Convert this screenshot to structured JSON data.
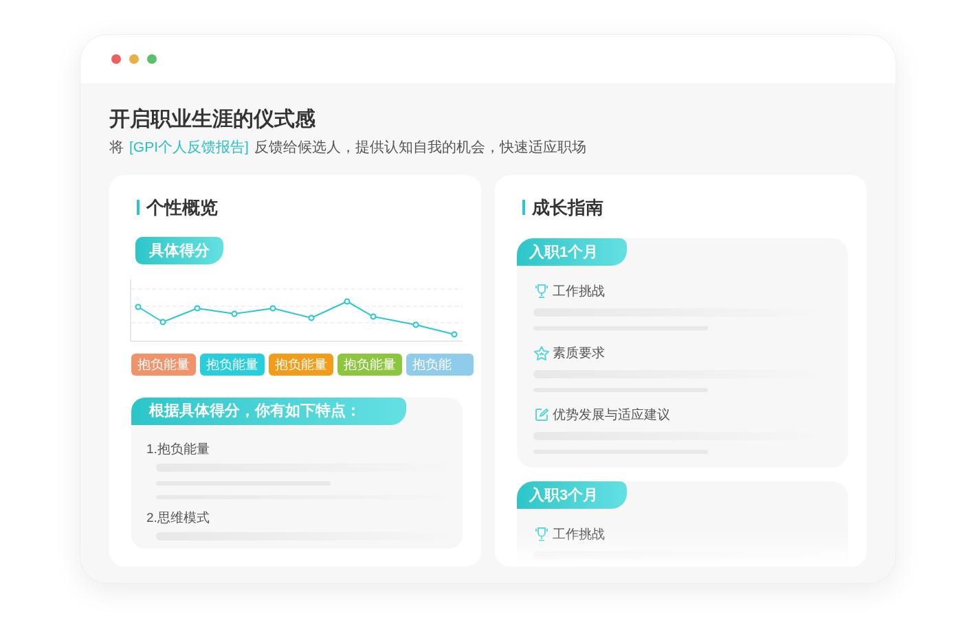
{
  "window": {
    "controls": [
      {
        "color": "#ec5f5f"
      },
      {
        "color": "#e9b04a"
      },
      {
        "color": "#5cc26a"
      }
    ]
  },
  "title": "开启职业生涯的仪式感",
  "subtitle": {
    "before": "将",
    "link": "[GPI个人反馈报告]",
    "after": "反馈给候选人，提供认知自我的机会，快速适应职场"
  },
  "overview": {
    "title": "个性概览",
    "score_badge": "具体得分",
    "tags": [
      {
        "label": "抱负能量",
        "color": "#f0926a"
      },
      {
        "label": "抱负能量",
        "color": "#27cedb"
      },
      {
        "label": "抱负能量",
        "color": "#f39c1a"
      },
      {
        "label": "抱负能量",
        "color": "#8cc63f"
      },
      {
        "label": "抱负能",
        "color": "#8fcbea"
      }
    ],
    "traits_header": "根据具体得分，你有如下特点：",
    "traits": [
      "1.抱负能量",
      "2.思维模式"
    ]
  },
  "guide": {
    "title": "成长指南",
    "stages": [
      {
        "label": "入职1个月",
        "items": [
          {
            "kind": "trophy",
            "label": "工作挑战"
          },
          {
            "kind": "star",
            "label": "素质要求"
          },
          {
            "kind": "edit",
            "label": "优势发展与适应建议"
          }
        ]
      },
      {
        "label": "入职3个月",
        "items": [
          {
            "kind": "trophy",
            "label": "工作挑战"
          }
        ]
      }
    ]
  }
}
